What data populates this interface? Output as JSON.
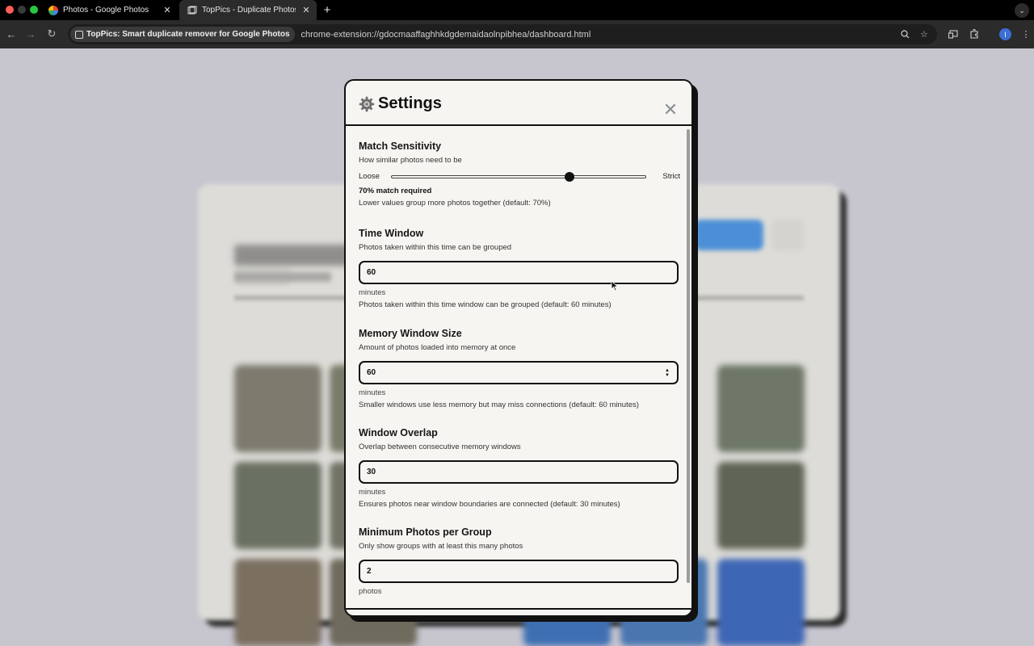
{
  "browser": {
    "tabs": [
      {
        "title": "Photos - Google Photos",
        "active": false
      },
      {
        "title": "TopPics - Duplicate Photos D",
        "active": true
      }
    ],
    "site_chip": "TopPics: Smart duplicate remover for Google Photos",
    "url": "chrome-extension://gdocmaaffaghhkdgdemaidaolnpibhea/dashboard.html",
    "profile_initial": "I"
  },
  "settings": {
    "title": "Settings",
    "match_sensitivity": {
      "title": "Match Sensitivity",
      "description": "How similar photos need to be",
      "min_label": "Loose",
      "max_label": "Strict",
      "value": 70,
      "status": "70% match required",
      "note": "Lower values group more photos together (default: 70%)"
    },
    "time_window": {
      "title": "Time Window",
      "description": "Photos taken within this time can be grouped",
      "value": "60",
      "unit": "minutes",
      "note": "Photos taken within this time window can be grouped (default: 60 minutes)"
    },
    "memory_window": {
      "title": "Memory Window Size",
      "description": "Amount of photos loaded into memory at once",
      "value": "60",
      "unit": "minutes",
      "note": "Smaller windows use less memory but may miss connections (default: 60 minutes)"
    },
    "window_overlap": {
      "title": "Window Overlap",
      "description": "Overlap between consecutive memory windows",
      "value": "30",
      "unit": "minutes",
      "note": "Ensures photos near window boundaries are connected (default: 30 minutes)"
    },
    "min_photos": {
      "title": "Minimum Photos per Group",
      "description": "Only show groups with at least this many photos",
      "value": "2",
      "unit": "photos"
    }
  },
  "colors": {
    "modal_bg": "#f7f5f1",
    "border": "#111111",
    "page_bg": "#c7c6cf"
  }
}
